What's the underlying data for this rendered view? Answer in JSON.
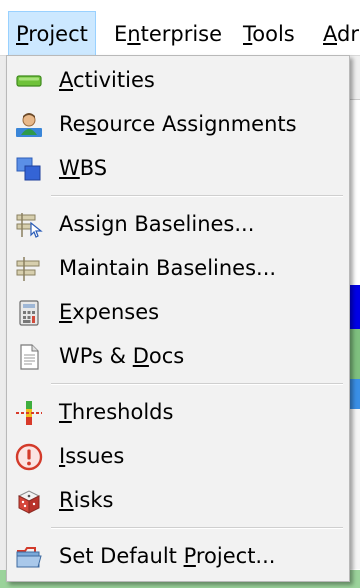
{
  "menubar": {
    "items": [
      {
        "pre": "",
        "ul": "P",
        "post": "roject"
      },
      {
        "pre": "E",
        "ul": "n",
        "post": "terprise"
      },
      {
        "pre": "",
        "ul": "T",
        "post": "ools"
      },
      {
        "pre": "",
        "ul": "A",
        "post": "dr"
      }
    ]
  },
  "menu": {
    "items": [
      {
        "pre": "",
        "ul": "A",
        "post": "ctivities",
        "icon": "activities-bar-icon"
      },
      {
        "pre": "Re",
        "ul": "s",
        "post": "ource Assignments",
        "icon": "resource-person-icon"
      },
      {
        "pre": "",
        "ul": "W",
        "post": "BS",
        "icon": "wbs-blocks-icon"
      },
      {
        "pre": "Assign Baselines...",
        "ul": "",
        "post": "",
        "icon": "assign-baselines-icon"
      },
      {
        "pre": "Maintain Baselines...",
        "ul": "",
        "post": "",
        "icon": "maintain-baselines-icon"
      },
      {
        "pre": "",
        "ul": "E",
        "post": "xpenses",
        "icon": "expenses-calculator-icon"
      },
      {
        "pre": "WPs & ",
        "ul": "D",
        "post": "ocs",
        "icon": "document-icon"
      },
      {
        "pre": "",
        "ul": "T",
        "post": "hresholds",
        "icon": "thresholds-icon"
      },
      {
        "pre": "",
        "ul": "I",
        "post": "ssues",
        "icon": "issues-warning-icon"
      },
      {
        "pre": "",
        "ul": "R",
        "post": "isks",
        "icon": "risks-dice-icon"
      },
      {
        "pre": "Set Default ",
        "ul": "P",
        "post": "roject...",
        "icon": "folder-icon"
      }
    ]
  },
  "colors": {
    "highlight": "#cce8ff",
    "menu_bg": "#f2f2f2"
  }
}
